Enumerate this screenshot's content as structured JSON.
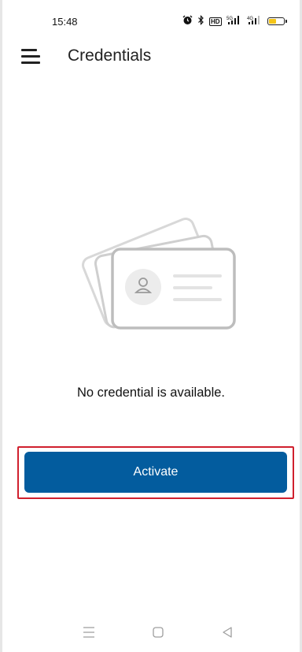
{
  "status_bar": {
    "time": "15:48",
    "icons": [
      "alarm-icon",
      "bluetooth-icon",
      "hd-icon",
      "signal-5g-icon",
      "signal-4g-icon",
      "battery-icon"
    ],
    "hd_label": "HD",
    "signal_5g_label": "5G",
    "signal_4g_label": "4G",
    "battery_color": "#f5c518"
  },
  "header": {
    "title": "Credentials",
    "menu_icon": "hamburger-menu-icon"
  },
  "main": {
    "illustration_icon": "id-cards-icon",
    "empty_message": "No credential is available.",
    "activate_label": "Activate",
    "activate_color": "#035c9e",
    "highlight_color": "#d0202e"
  },
  "nav_bar": {
    "icons": [
      "nav-menu-icon",
      "nav-home-icon",
      "nav-back-icon"
    ]
  }
}
